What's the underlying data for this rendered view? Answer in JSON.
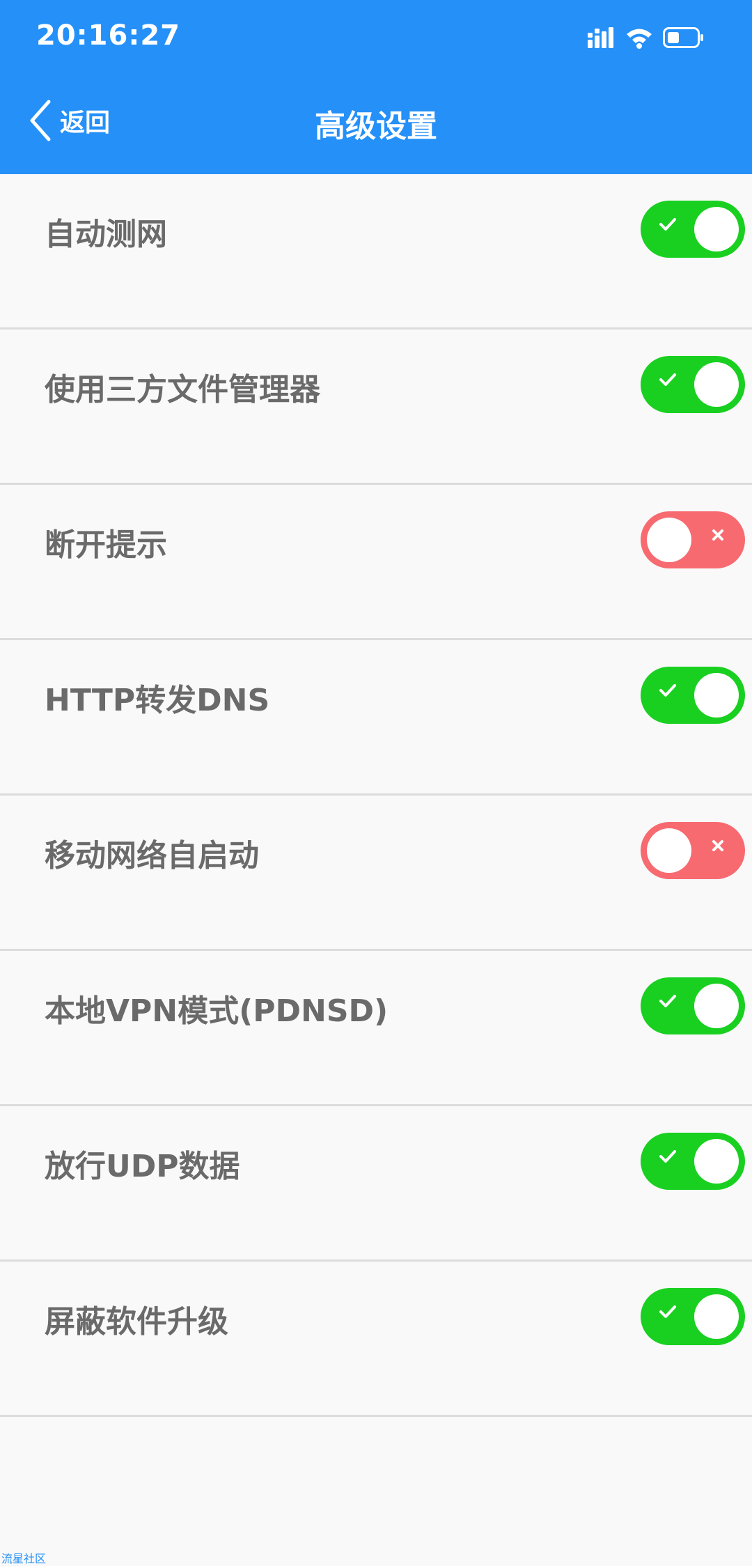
{
  "status_bar": {
    "time": "20:16:27",
    "icons": [
      "signal-icon",
      "wifi-icon",
      "battery-icon"
    ]
  },
  "nav": {
    "back_label": "返回",
    "title": "高级设置"
  },
  "settings": [
    {
      "label": "自动测网",
      "enabled": true
    },
    {
      "label": "使用三方文件管理器",
      "enabled": true
    },
    {
      "label": "断开提示",
      "enabled": false
    },
    {
      "label": "HTTP转发DNS",
      "enabled": true
    },
    {
      "label": "移动网络自启动",
      "enabled": false
    },
    {
      "label": "本地VPN模式(PDNSD)",
      "enabled": true
    },
    {
      "label": "放行UDP数据",
      "enabled": true
    },
    {
      "label": "屏蔽软件升级",
      "enabled": true
    }
  ],
  "watermark": "流星社区",
  "colors": {
    "header": "#2490f8",
    "toggle_on": "#19d021",
    "toggle_off": "#f76a70",
    "label_text": "#6a6a6a"
  }
}
